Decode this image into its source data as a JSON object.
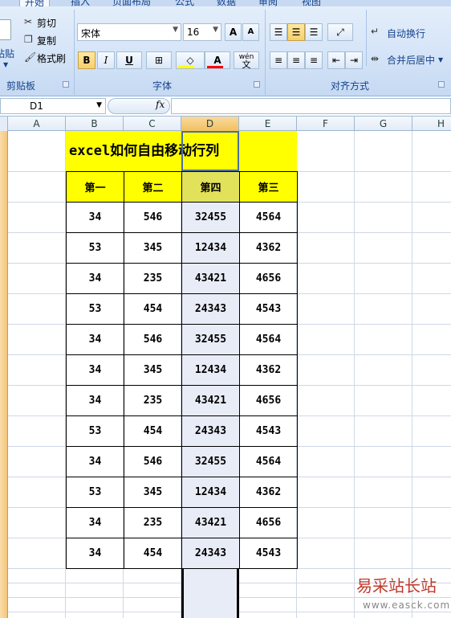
{
  "ribbon": {
    "tabs": [
      "开始",
      "插入",
      "页面布局",
      "公式",
      "数据",
      "审阅",
      "视图"
    ],
    "clipboard": {
      "paste_label": "粘贴",
      "cut_label": "剪切",
      "copy_label": "复制",
      "format_painter_label": "格式刷",
      "group_label": "剪贴板"
    },
    "font": {
      "font_name": "宋体",
      "font_size": "16",
      "grow_label": "A",
      "shrink_label": "A",
      "bold_label": "B",
      "italic_label": "I",
      "underline_label": "U",
      "font_color_label": "A",
      "phonetic_label": "文",
      "phonetic_top": "wén",
      "group_label": "字体"
    },
    "alignment": {
      "wrap_label": "自动换行",
      "merge_label": "合并后居中",
      "group_label": "对齐方式"
    },
    "colors": {
      "fill_swatch": "#ffff00",
      "font_swatch": "#ff0000"
    }
  },
  "formula_bar": {
    "name_box": "D1",
    "fx_label": "fx",
    "formula": ""
  },
  "columns": [
    "A",
    "B",
    "C",
    "D",
    "E",
    "F",
    "G",
    "H"
  ],
  "sheet": {
    "title": "excel如何自由移动行列",
    "headers": [
      "第一",
      "第二",
      "第四",
      "第三"
    ],
    "rows": [
      [
        "34",
        "546",
        "32455",
        "4564"
      ],
      [
        "53",
        "345",
        "12434",
        "4362"
      ],
      [
        "34",
        "235",
        "43421",
        "4656"
      ],
      [
        "53",
        "454",
        "24343",
        "4543"
      ],
      [
        "34",
        "546",
        "32455",
        "4564"
      ],
      [
        "34",
        "345",
        "12434",
        "4362"
      ],
      [
        "34",
        "235",
        "43421",
        "4656"
      ],
      [
        "53",
        "454",
        "24343",
        "4543"
      ],
      [
        "34",
        "546",
        "32455",
        "4564"
      ],
      [
        "53",
        "345",
        "12434",
        "4362"
      ],
      [
        "34",
        "235",
        "43421",
        "4656"
      ],
      [
        "34",
        "454",
        "24343",
        "4543"
      ]
    ]
  },
  "watermark": {
    "text": "易采站长站",
    "url": "www.easck.com"
  }
}
